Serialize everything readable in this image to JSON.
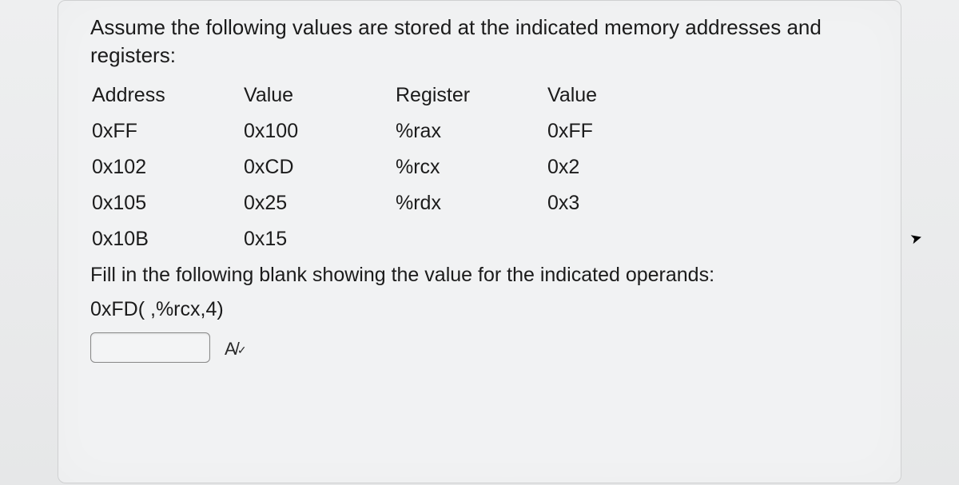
{
  "intro": "Assume the following values are stored at the indicated memory addresses and registers:",
  "headers": {
    "addr": "Address",
    "val1": "Value",
    "reg": "Register",
    "val2": "Value"
  },
  "rows": [
    {
      "addr": "0xFF",
      "val1": "0x100",
      "reg": "%rax",
      "val2": "0xFF"
    },
    {
      "addr": "0x102",
      "val1": "0xCD",
      "reg": "%rcx",
      "val2": "0x2"
    },
    {
      "addr": "0x105",
      "val1": "0x25",
      "reg": "%rdx",
      "val2": "0x3"
    },
    {
      "addr": "0x10B",
      "val1": "0x15",
      "reg": "",
      "val2": ""
    }
  ],
  "prompt2": "Fill in the following blank showing the value for the indicated operands:",
  "operand": "0xFD( ,%rcx,4)",
  "answer_value": "",
  "answer_placeholder": ""
}
